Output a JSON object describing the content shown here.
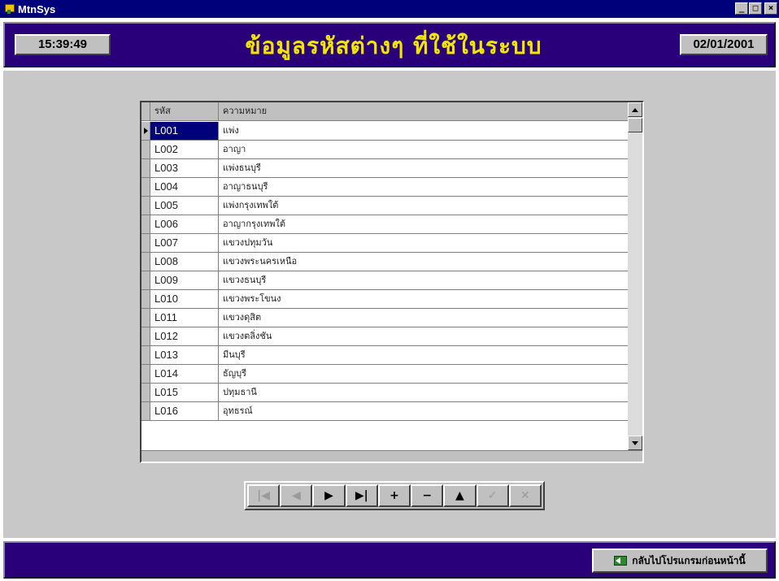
{
  "window": {
    "title": "MtnSys",
    "controls": [
      "_",
      "□",
      "×"
    ]
  },
  "header": {
    "clock": "15:39:49",
    "title": "ข้อมูลรหัสต่างๆ ที่ใช้ในระบบ",
    "date": "02/01/2001"
  },
  "grid": {
    "columns": [
      "รหัส",
      "ความหมาย"
    ],
    "selected_row": 0,
    "rows": [
      {
        "code": "L001",
        "desc": "แพ่ง"
      },
      {
        "code": "L002",
        "desc": "อาญา"
      },
      {
        "code": "L003",
        "desc": "แพ่งธนบุรี"
      },
      {
        "code": "L004",
        "desc": "อาญาธนบุรี"
      },
      {
        "code": "L005",
        "desc": "แพ่งกรุงเทพใต้"
      },
      {
        "code": "L006",
        "desc": "อาญากรุงเทพใต้"
      },
      {
        "code": "L007",
        "desc": "แขวงปทุมวัน"
      },
      {
        "code": "L008",
        "desc": "แขวงพระนครเหนือ"
      },
      {
        "code": "L009",
        "desc": "แขวงธนบุรี"
      },
      {
        "code": "L010",
        "desc": "แขวงพระโขนง"
      },
      {
        "code": "L011",
        "desc": "แขวงดุสิต"
      },
      {
        "code": "L012",
        "desc": "แขวงตลิ่งชัน"
      },
      {
        "code": "L013",
        "desc": "มีนบุรี"
      },
      {
        "code": "L014",
        "desc": "ธัญบุรี"
      },
      {
        "code": "L015",
        "desc": "ปทุมธานี"
      },
      {
        "code": "L016",
        "desc": "อุทธรณ์"
      }
    ]
  },
  "navigator": {
    "buttons": [
      {
        "glyph": "|◀",
        "name": "first-record-button",
        "disabled": true
      },
      {
        "glyph": "◀",
        "name": "prior-record-button",
        "disabled": true
      },
      {
        "glyph": "▶",
        "name": "next-record-button",
        "disabled": false
      },
      {
        "glyph": "▶|",
        "name": "last-record-button",
        "disabled": false
      },
      {
        "glyph": "+",
        "name": "insert-record-button",
        "disabled": false
      },
      {
        "glyph": "−",
        "name": "delete-record-button",
        "disabled": false
      },
      {
        "glyph": "▲",
        "name": "edit-record-button",
        "disabled": false
      },
      {
        "glyph": "✓",
        "name": "post-record-button",
        "disabled": true
      },
      {
        "glyph": "✕",
        "name": "cancel-record-button",
        "disabled": true
      }
    ]
  },
  "footer": {
    "back_label": "กลับไปโปรแกรมก่อนหน้านี้"
  }
}
